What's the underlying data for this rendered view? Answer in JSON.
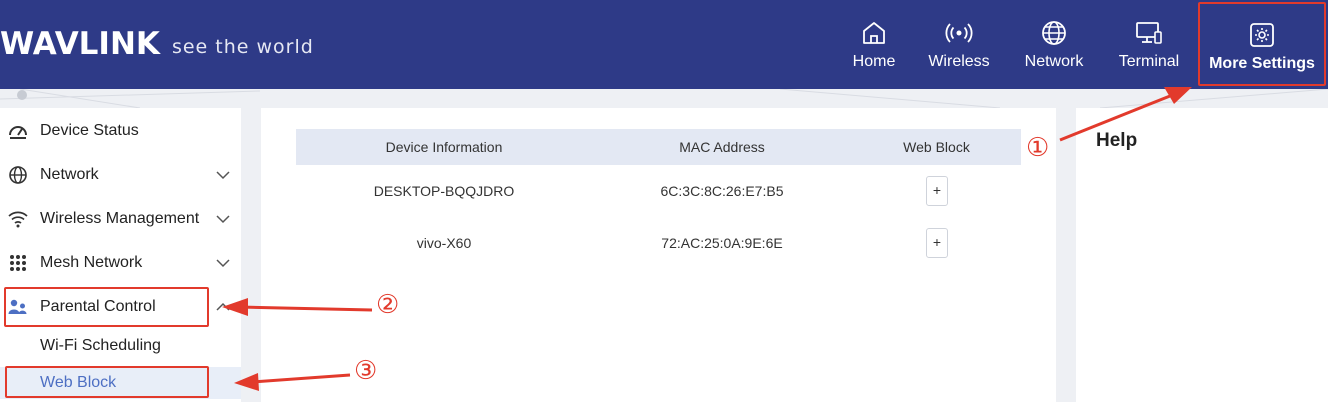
{
  "brand": {
    "name": "WAVLINK",
    "tagline": "see the world"
  },
  "top_nav": [
    {
      "label": "Home",
      "icon": "home-icon"
    },
    {
      "label": "Wireless",
      "icon": "wireless-icon"
    },
    {
      "label": "Network",
      "icon": "globe-icon"
    },
    {
      "label": "Terminal",
      "icon": "monitor-icon"
    },
    {
      "label": "More Settings",
      "icon": "settings-gear-icon",
      "active": true
    }
  ],
  "sidebar": {
    "items": [
      {
        "label": "Device Status",
        "icon": "dashboard-icon"
      },
      {
        "label": "Network",
        "icon": "globe-icon",
        "expandable": true
      },
      {
        "label": "Wireless Management",
        "icon": "wifi-icon",
        "expandable": true
      },
      {
        "label": "Mesh Network",
        "icon": "grid-dots-icon",
        "expandable": true
      },
      {
        "label": "Parental Control",
        "icon": "parent-child-icon",
        "expandable": true,
        "expanded": true
      }
    ],
    "sub_items": [
      {
        "label": "Wi-Fi Scheduling"
      },
      {
        "label": "Web Block",
        "active": true
      }
    ]
  },
  "device_table": {
    "columns": [
      "Device Information",
      "MAC Address",
      "Web Block"
    ],
    "rows": [
      {
        "device": "DESKTOP-BQQJDRO",
        "mac": "6C:3C:8C:26:E7:B5",
        "action": "+"
      },
      {
        "device": "vivo-X60",
        "mac": "72:AC:25:0A:9E:6E",
        "action": "+"
      }
    ]
  },
  "help": {
    "title": "Help"
  },
  "annotations": {
    "marker_1": "①",
    "marker_2": "②",
    "marker_3": "③"
  },
  "colors": {
    "header_bg": "#2e3a87",
    "annotation_red": "#e23a2c",
    "active_sub_bg": "#e8eef8",
    "active_sub_text": "#4d6fc3",
    "table_head_bg": "#e3e8f3"
  }
}
